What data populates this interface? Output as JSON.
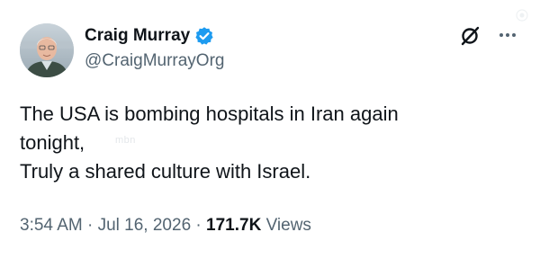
{
  "author": {
    "display_name": "Craig Murray",
    "handle": "@CraigMurrayOrg",
    "verified": true
  },
  "tweet": {
    "lines": [
      "The USA is bombing hospitals in Iran again",
      "tonight,",
      "Truly a shared culture with Israel."
    ],
    "watermark": "mbn"
  },
  "meta": {
    "time": "3:54 AM",
    "separator1": " · ",
    "date": "Jul 16, 2026",
    "separator2": " · ",
    "views_count": "171.7K",
    "views_label": " Views"
  },
  "icons": {
    "verified": "verified-badge-icon",
    "grok": "grok-icon",
    "more": "more-options-icon"
  },
  "colors": {
    "verified": "#1d9bf0",
    "text": "#0f1419",
    "secondary": "#536471"
  }
}
